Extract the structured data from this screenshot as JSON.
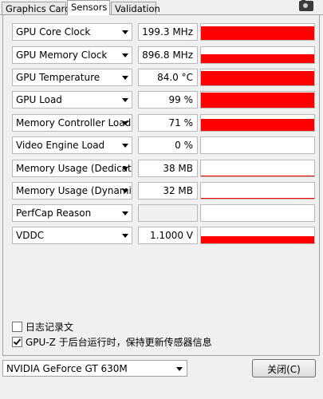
{
  "tabs": [
    {
      "label": "Graphics Card"
    },
    {
      "label": "Sensors"
    },
    {
      "label": "Validation"
    }
  ],
  "sensors": [
    {
      "label": "GPU Core Clock",
      "value": "199.3 MHz",
      "level": 0.85
    },
    {
      "label": "GPU Memory Clock",
      "value": "896.8 MHz",
      "level": 0.55
    },
    {
      "label": "GPU Temperature",
      "value": "84.0 °C",
      "level": 0.88
    },
    {
      "label": "GPU Load",
      "value": "99 %",
      "level": 0.95
    },
    {
      "label": "Memory Controller Load",
      "value": "71 %",
      "level": 0.75
    },
    {
      "label": "Video Engine Load",
      "value": "0 %",
      "level": 0
    },
    {
      "label": "Memory Usage (Dedicated)",
      "value": "38 MB",
      "level": 0.05
    },
    {
      "label": "Memory Usage (Dynamic)",
      "value": "32 MB",
      "level": 0.05
    },
    {
      "label": "PerfCap Reason",
      "value": "",
      "level": 0
    },
    {
      "label": "VDDC",
      "value": "1.1000 V",
      "level": 0.45
    }
  ],
  "options": {
    "log_to_file_label": "日志记录文",
    "log_to_file_checked": false,
    "background_update_label": "GPU-Z 于后台运行时，保持更新传感器信息",
    "background_update_checked": true
  },
  "gpu_selector": {
    "selected": "NVIDIA GeForce GT 630M"
  },
  "close_button": {
    "label": "关闭(C)"
  },
  "colors": {
    "graph": "#ff0000"
  },
  "icons": {
    "screenshot": "camera-icon",
    "dropdown": "chevron-down-icon"
  }
}
